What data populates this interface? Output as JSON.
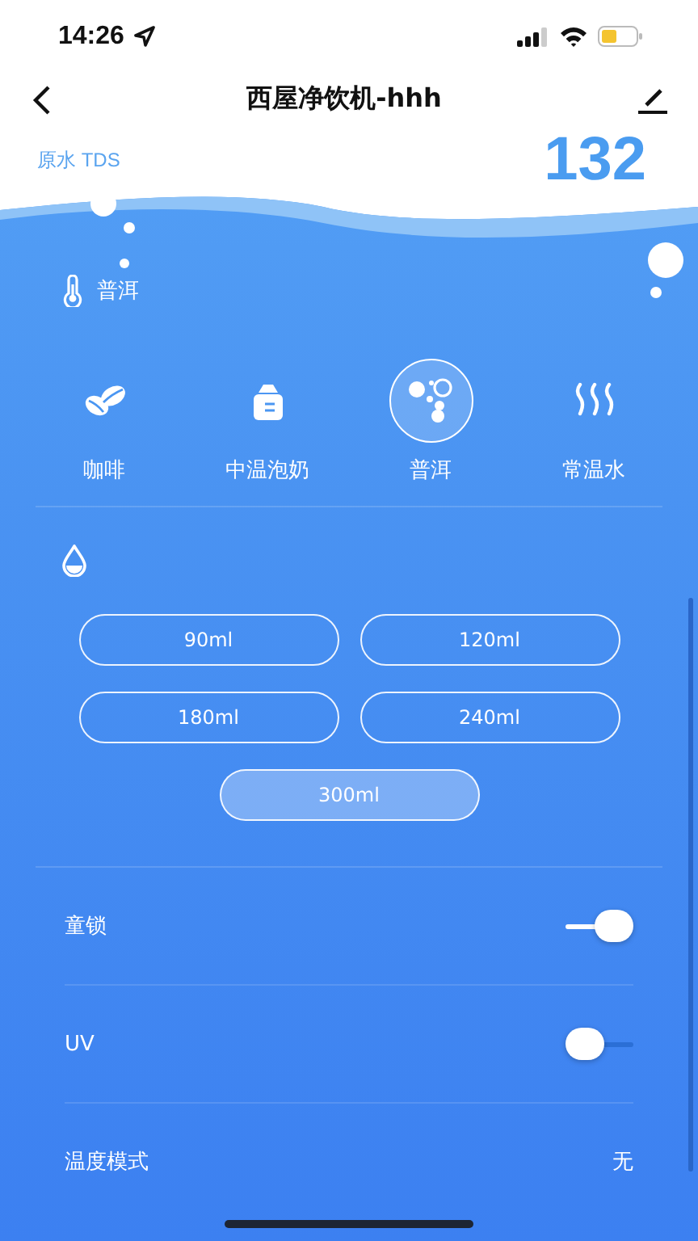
{
  "status_bar": {
    "time": "14:26"
  },
  "nav": {
    "title": "西屋净饮机-hhh"
  },
  "tds": {
    "label": "原水 TDS",
    "value": "132"
  },
  "current_drink": {
    "label": "普洱"
  },
  "drinks": [
    {
      "label": "咖啡",
      "kind": "coffee",
      "selected": false
    },
    {
      "label": "中温泡奶",
      "kind": "milk",
      "selected": false
    },
    {
      "label": "普洱",
      "kind": "tea",
      "selected": true
    },
    {
      "label": "常温水",
      "kind": "water",
      "selected": false
    }
  ],
  "volumes": [
    {
      "label": "90ml",
      "selected": false
    },
    {
      "label": "120ml",
      "selected": false
    },
    {
      "label": "180ml",
      "selected": false
    },
    {
      "label": "240ml",
      "selected": false
    },
    {
      "label": "300ml",
      "selected": true
    }
  ],
  "settings": [
    {
      "kind": "toggle",
      "label": "童锁",
      "on": true
    },
    {
      "kind": "toggle",
      "label": "UV",
      "on": false
    },
    {
      "kind": "value",
      "label": "温度模式",
      "value": "无"
    }
  ]
}
